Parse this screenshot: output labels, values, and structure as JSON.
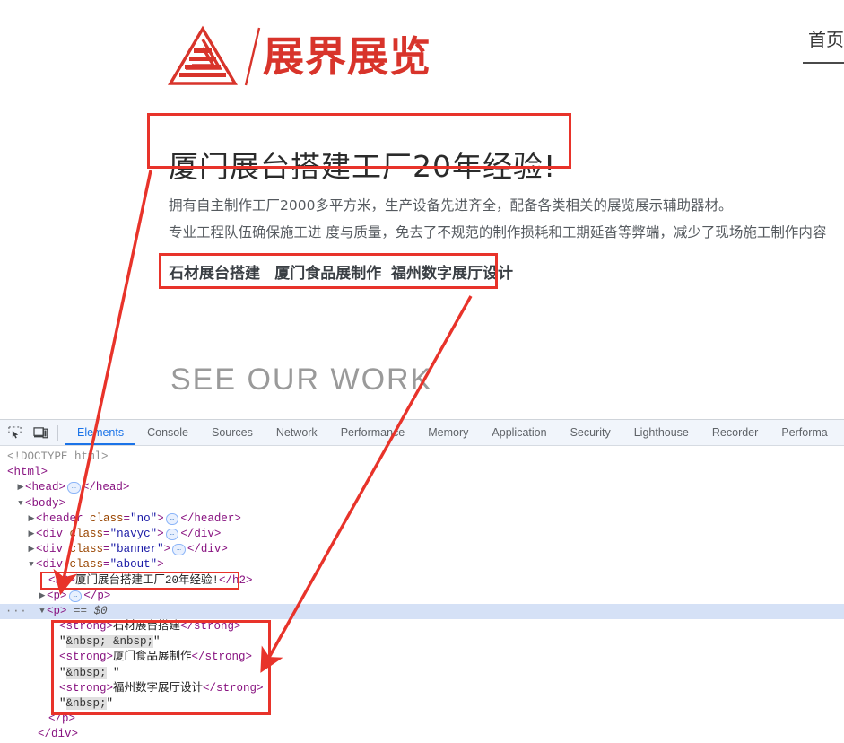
{
  "page": {
    "logo": {
      "icon": "pyramid-logo-icon",
      "text": "展界展览",
      "color": "#d8342b"
    },
    "nav": {
      "items": [
        {
          "label": "首页"
        }
      ]
    },
    "headline": "厦门展台搭建工厂20年经验!",
    "paragraph_lines": [
      "拥有自主制作工厂2000多平方米，生产设备先进齐全，配备各类相关的展览展示辅助器材。",
      "专业工程队伍确保施工进 度与质量，免去了不规范的制作损耗和工期延沓等弊端，减少了现场施工制作内容"
    ],
    "keywords": [
      "石材展台搭建",
      "厦门食品展制作",
      "福州数字展厅设计"
    ],
    "section_title": "SEE OUR WORK"
  },
  "devtools": {
    "toolbar": {
      "inspect_icon": "inspect-element-icon",
      "device_icon": "device-toolbar-icon",
      "tabs": [
        {
          "label": "Elements",
          "active": true
        },
        {
          "label": "Console",
          "active": false
        },
        {
          "label": "Sources",
          "active": false
        },
        {
          "label": "Network",
          "active": false
        },
        {
          "label": "Performance",
          "active": false
        },
        {
          "label": "Memory",
          "active": false
        },
        {
          "label": "Application",
          "active": false
        },
        {
          "label": "Security",
          "active": false
        },
        {
          "label": "Lighthouse",
          "active": false
        },
        {
          "label": "Recorder",
          "active": false
        },
        {
          "label": "Performa",
          "active": false
        }
      ]
    },
    "dom": {
      "doctype": "<!DOCTYPE html>",
      "row_html_open": "<html>",
      "row_head": {
        "tag": "head",
        "open": "<head>",
        "close": "</head>",
        "collapsed": "…"
      },
      "row_body_open": "<body>",
      "row_header": {
        "open_a": "<header",
        "attr": "class",
        "value": "\"no\"",
        "open_b": ">",
        "close": "</header>",
        "collapsed": "…"
      },
      "row_div_navyc": {
        "open_a": "<div",
        "attr": "class",
        "value": "\"navyc\"",
        "open_b": ">",
        "close": "</div>",
        "collapsed": "…"
      },
      "row_div_banner": {
        "open_a": "<div",
        "attr": "class",
        "value": "\"banner\"",
        "open_b": ">",
        "close": "</div>",
        "collapsed": "…"
      },
      "row_div_about": {
        "open_a": "<div",
        "attr": "class",
        "value": "\"about\"",
        "open_b": ">"
      },
      "row_h2": {
        "open": "<h2>",
        "text": "厦门展台搭建工厂20年经验!",
        "close": "</h2>"
      },
      "row_p_collapsed": {
        "open": "<p>",
        "collapsed": "…",
        "close": "</p>"
      },
      "row_p_selected": {
        "open": "<p>",
        "eq": "==",
        "ref": "$0",
        "dots": "···"
      },
      "strong_children": [
        {
          "open": "<strong>",
          "text": "石材展台搭建",
          "close": "</strong>"
        },
        {
          "entity": "\"&nbsp; &nbsp;\""
        },
        {
          "open": "<strong>",
          "text": "厦门食品展制作",
          "close": "</strong>"
        },
        {
          "entity": "\"&nbsp; \""
        },
        {
          "open": "<strong>",
          "text": "福州数字展厅设计",
          "close": "</strong>"
        },
        {
          "entity": "\"&nbsp;\""
        }
      ],
      "row_p_close": "</p>",
      "row_div_close": "</div>"
    }
  },
  "annotations": {
    "color": "#e8332a",
    "boxes": [
      {
        "name": "headline-box"
      },
      {
        "name": "keywords-box"
      },
      {
        "name": "h2-row-box"
      },
      {
        "name": "strong-children-box"
      }
    ],
    "arrows": [
      {
        "name": "headline-to-h2-arrow"
      },
      {
        "name": "keywords-to-strong-arrow"
      }
    ]
  }
}
